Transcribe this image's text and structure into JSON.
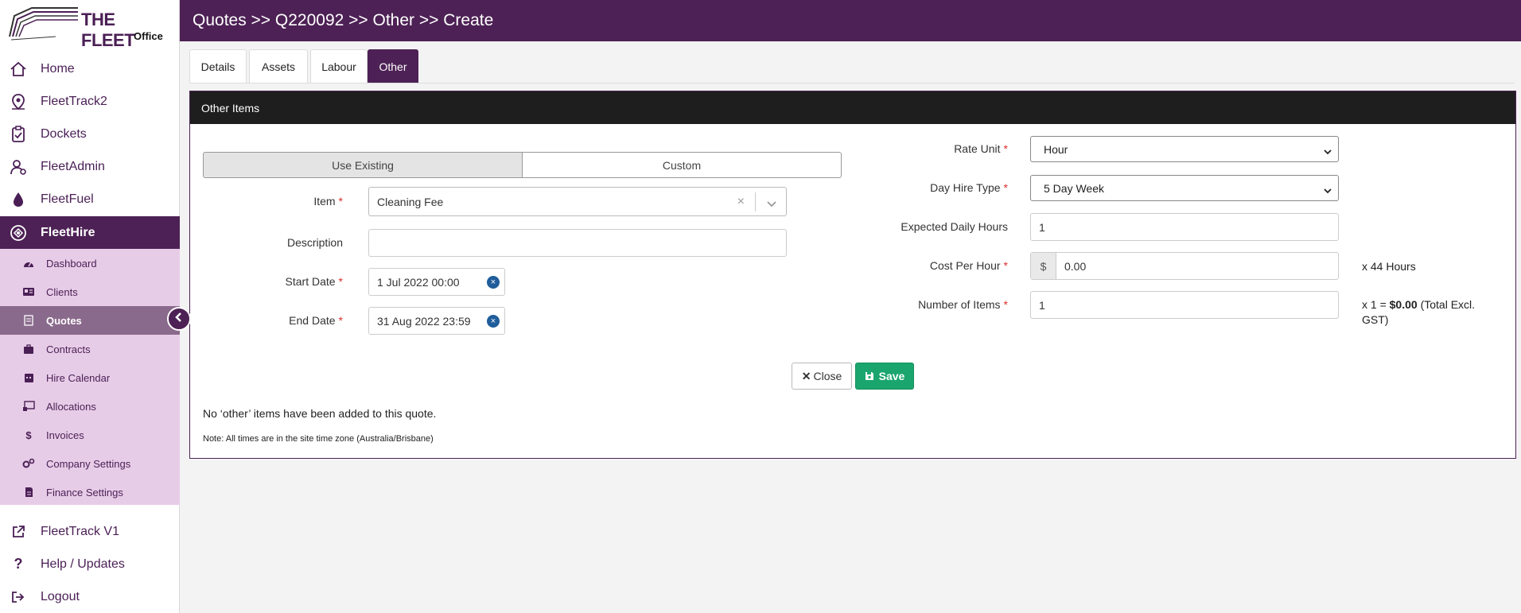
{
  "logo": {
    "main": "THE FLEET",
    "sub": "Office"
  },
  "header": {
    "title": "Quotes >> Q220092 >> Other >> Create"
  },
  "sidebar": {
    "items": [
      {
        "label": "Home",
        "icon": "home-icon"
      },
      {
        "label": "FleetTrack2",
        "icon": "location-pin-icon"
      },
      {
        "label": "Dockets",
        "icon": "clipboard-check-icon"
      },
      {
        "label": "FleetAdmin",
        "icon": "user-gear-icon"
      },
      {
        "label": "FleetFuel",
        "icon": "droplet-icon"
      },
      {
        "label": "FleetHire",
        "icon": "fleethire-logo-icon"
      }
    ],
    "submenu": [
      {
        "label": "Dashboard",
        "icon": "gauge-icon"
      },
      {
        "label": "Clients",
        "icon": "id-card-icon"
      },
      {
        "label": "Quotes",
        "icon": "document-icon"
      },
      {
        "label": "Contracts",
        "icon": "briefcase-icon"
      },
      {
        "label": "Hire Calendar",
        "icon": "calendar-icon"
      },
      {
        "label": "Allocations",
        "icon": "allocation-icon"
      },
      {
        "label": "Invoices",
        "icon": "dollar-icon"
      },
      {
        "label": "Company Settings",
        "icon": "gears-icon"
      },
      {
        "label": "Finance Settings",
        "icon": "receipt-icon"
      }
    ],
    "bottom": [
      {
        "label": "FleetTrack V1",
        "icon": "external-link-icon"
      },
      {
        "label": "Help / Updates",
        "icon": "question-icon"
      },
      {
        "label": "Logout",
        "icon": "logout-icon"
      }
    ]
  },
  "tabs": [
    {
      "label": "Details"
    },
    {
      "label": "Assets"
    },
    {
      "label": "Labour"
    },
    {
      "label": "Other"
    }
  ],
  "panel": {
    "title": "Other Items",
    "toggle": {
      "existing": "Use Existing",
      "custom": "Custom"
    },
    "fields": {
      "item": {
        "label": "Item",
        "value": "Cleaning Fee"
      },
      "description": {
        "label": "Description",
        "value": ""
      },
      "start_date": {
        "label": "Start Date",
        "value": "1 Jul 2022 00:00"
      },
      "end_date": {
        "label": "End Date",
        "value": "31 Aug 2022 23:59"
      },
      "rate_unit": {
        "label": "Rate Unit",
        "value": "Hour"
      },
      "day_hire_type": {
        "label": "Day Hire Type",
        "value": "5 Day Week"
      },
      "expected_daily_hours": {
        "label": "Expected Daily Hours",
        "value": "1"
      },
      "cost_per_hour": {
        "label": "Cost Per Hour",
        "prefix": "$",
        "value": "0.00",
        "aside": "x 44 Hours"
      },
      "number_of_items": {
        "label": "Number of Items",
        "value": "1",
        "aside_prefix": "x 1 = ",
        "aside_total": "$0.00",
        "aside_suffix": " (Total Excl.",
        "aside_line2": "GST)"
      }
    },
    "close_label": "Close",
    "save_label": "Save",
    "empty_message": "No ‘other’ items have been added to this quote.",
    "note": "Note: All times are in the site time zone (Australia/Brisbane)"
  }
}
